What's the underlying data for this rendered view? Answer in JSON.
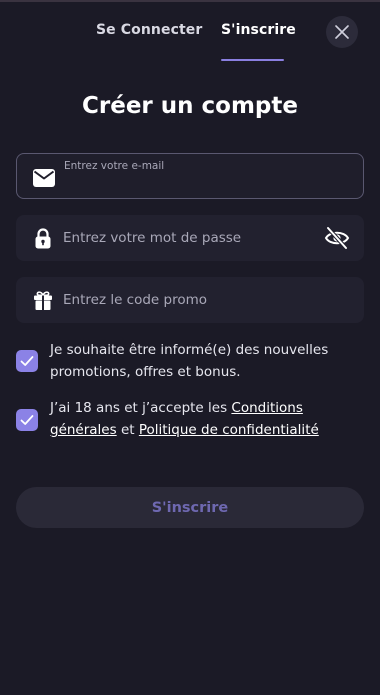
{
  "tabs": {
    "login_label": "Se Connecter",
    "register_label": "S'inscrire"
  },
  "title": "Créer un compte",
  "form": {
    "email": {
      "label": "Entrez votre e-mail",
      "value": ""
    },
    "password": {
      "placeholder": "Entrez votre mot de passe",
      "value": ""
    },
    "promo": {
      "placeholder": "Entrez le code promo",
      "value": ""
    }
  },
  "checkboxes": {
    "newsletter": {
      "checked": true,
      "text": "Je souhaite être informé(e) des nouvelles promotions, offres et bonus."
    },
    "terms": {
      "checked": true,
      "text_before": "J’ai 18 ans et j’accepte les ",
      "terms_link": "Conditions générales",
      "text_middle": " et ",
      "privacy_link": "Politique de confidentialité"
    }
  },
  "submit_label": "S'inscrire",
  "colors": {
    "background": "#1b1a26",
    "accent": "#8b82e6",
    "field_bg": "#22212f",
    "submit_text": "#6e68b0"
  },
  "icons": {
    "close": "close-icon",
    "email": "envelope-icon",
    "password": "lock-icon",
    "password_toggle": "eye-off-icon",
    "promo": "gift-icon",
    "check": "checkmark-icon"
  }
}
